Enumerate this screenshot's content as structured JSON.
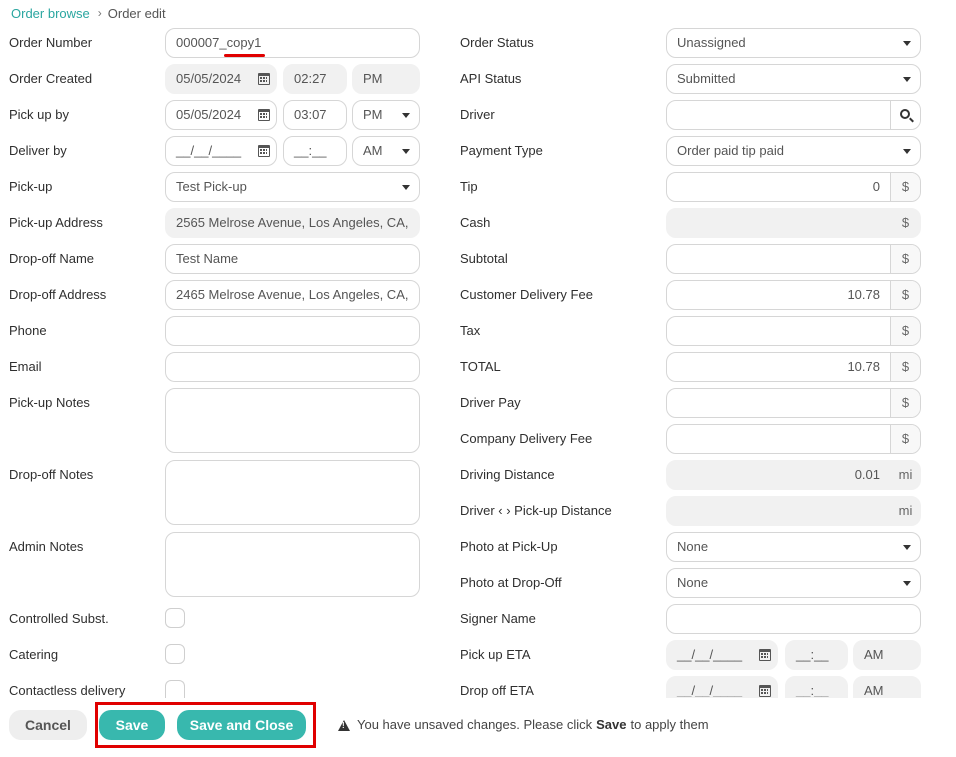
{
  "breadcrumb": {
    "root": "Order browse",
    "separator": "›",
    "current": "Order edit"
  },
  "left": {
    "order_number": {
      "label": "Order Number",
      "value": "000007_copy1"
    },
    "order_created": {
      "label": "Order Created",
      "date": "05/05/2024",
      "time": "02:27",
      "ampm": "PM"
    },
    "pick_up_by": {
      "label": "Pick up by",
      "date": "05/05/2024",
      "time": "03:07",
      "ampm": "PM"
    },
    "deliver_by": {
      "label": "Deliver by",
      "date": "__/__/____",
      "time": "__:__",
      "ampm": "AM"
    },
    "pick_up": {
      "label": "Pick-up",
      "value": "Test Pick-up"
    },
    "pick_up_address": {
      "label": "Pick-up Address",
      "value": "2565 Melrose Avenue, Los Angeles, CA,"
    },
    "drop_off_name": {
      "label": "Drop-off Name",
      "value": "Test Name"
    },
    "drop_off_address": {
      "label": "Drop-off Address",
      "value": "2465 Melrose Avenue, Los Angeles, CA,"
    },
    "phone": {
      "label": "Phone",
      "value": ""
    },
    "email": {
      "label": "Email",
      "value": ""
    },
    "pick_up_notes": {
      "label": "Pick-up Notes"
    },
    "drop_off_notes": {
      "label": "Drop-off Notes"
    },
    "admin_notes": {
      "label": "Admin Notes"
    },
    "controlled_subst": {
      "label": "Controlled Subst.",
      "checked": false
    },
    "catering": {
      "label": "Catering",
      "checked": false
    },
    "contactless_delivery": {
      "label": "Contactless delivery",
      "checked": false
    }
  },
  "right": {
    "order_status": {
      "label": "Order Status",
      "value": "Unassigned"
    },
    "api_status": {
      "label": "API Status",
      "value": "Submitted"
    },
    "driver": {
      "label": "Driver",
      "value": ""
    },
    "payment_type": {
      "label": "Payment Type",
      "value": "Order paid tip paid"
    },
    "tip": {
      "label": "Tip",
      "value": "0",
      "unit": "$"
    },
    "cash": {
      "label": "Cash",
      "value": "",
      "unit": "$"
    },
    "subtotal": {
      "label": "Subtotal",
      "value": "",
      "unit": "$"
    },
    "customer_delivery_fee": {
      "label": "Customer Delivery Fee",
      "value": "10.78",
      "unit": "$"
    },
    "tax": {
      "label": "Tax",
      "value": "",
      "unit": "$"
    },
    "total": {
      "label": "TOTAL",
      "value": "10.78",
      "unit": "$"
    },
    "driver_pay": {
      "label": "Driver Pay",
      "value": "",
      "unit": "$"
    },
    "company_delivery_fee": {
      "label": "Company Delivery Fee",
      "value": "",
      "unit": "$"
    },
    "driving_distance": {
      "label": "Driving Distance",
      "value": "0.01",
      "unit": "mi"
    },
    "driver_pickup_distance": {
      "label": "Driver ‹ › Pick-up Distance",
      "value": "",
      "unit": "mi"
    },
    "photo_at_pickup": {
      "label": "Photo at Pick-Up",
      "value": "None"
    },
    "photo_at_dropoff": {
      "label": "Photo at Drop-Off",
      "value": "None"
    },
    "signer_name": {
      "label": "Signer Name",
      "value": ""
    },
    "pick_up_eta": {
      "label": "Pick up ETA",
      "date": "__/__/____",
      "time": "__:__",
      "ampm": "AM"
    },
    "drop_off_eta": {
      "label": "Drop off ETA",
      "date": "__/__/____",
      "time": "__:__",
      "ampm": "AM"
    }
  },
  "footer": {
    "cancel_label": "Cancel",
    "save_label": "Save",
    "save_close_label": "Save and Close",
    "notice_prefix": "You have unsaved changes. Please click",
    "notice_bold": "Save",
    "notice_suffix": "to apply them"
  },
  "colors": {
    "accent": "#38b8ae",
    "highlight": "#e00000",
    "link": "#2aa6a0"
  }
}
